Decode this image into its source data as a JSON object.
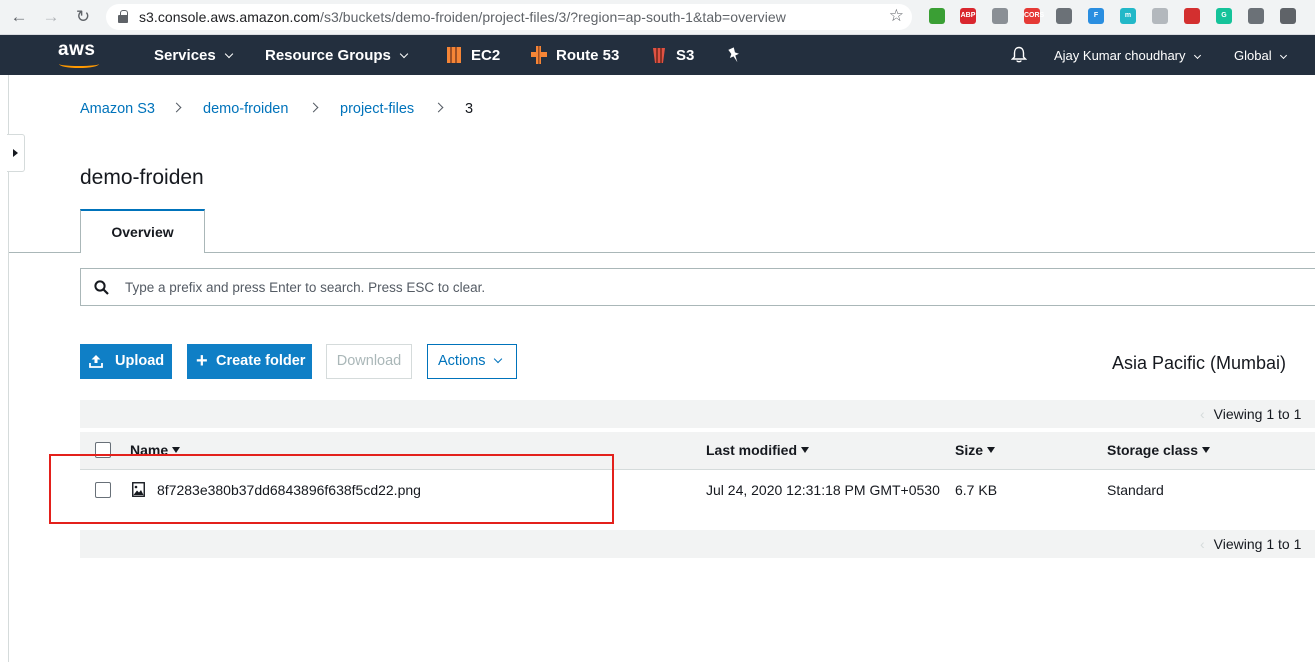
{
  "browser": {
    "url_host": "s3.console.aws.amazon.com",
    "url_path": "/s3/buckets/demo-froiden/project-files/3/?region=ap-south-1&tab=overview",
    "extensions": [
      {
        "name": "evernote-icon",
        "label": "",
        "color": "#3a9f34"
      },
      {
        "name": "adblock-plus-icon",
        "label": "ABP",
        "color": "#d9262e"
      },
      {
        "name": "vuejs-devtools-icon",
        "label": "",
        "color": "#8a8f95"
      },
      {
        "name": "cors-icon",
        "label": "CORS",
        "color": "#e53935"
      },
      {
        "name": "code-braces-icon",
        "label": "",
        "color": "#6b7177"
      },
      {
        "name": "font-icon",
        "label": "F",
        "color": "#2a8ee0"
      },
      {
        "name": "mercury-icon",
        "label": "m",
        "color": "#22b8c8"
      },
      {
        "name": "shape-icon",
        "label": "",
        "color": "#b3b8bd"
      },
      {
        "name": "pin-icon",
        "label": "",
        "color": "#d32f2f"
      },
      {
        "name": "grammarly-icon",
        "label": "G",
        "color": "#15c39a"
      },
      {
        "name": "camera-icon",
        "label": "",
        "color": "#6b7177"
      },
      {
        "name": "download-icon",
        "label": "",
        "color": "#5f6368"
      }
    ]
  },
  "aws_nav": {
    "logo_text": "aws",
    "services": "Services",
    "resource_groups": "Resource Groups",
    "shortcuts": [
      {
        "label": "EC2",
        "icon": "ec2-icon",
        "color": "#f58536"
      },
      {
        "label": "Route 53",
        "icon": "route53-icon",
        "color": "#f58536"
      },
      {
        "label": "S3",
        "icon": "s3-icon",
        "color": "#e05243"
      }
    ],
    "user": "Ajay Kumar choudhary",
    "region": "Global"
  },
  "breadcrumb": [
    "Amazon S3",
    "demo-froiden",
    "project-files",
    "3"
  ],
  "page_title": "demo-froiden",
  "tabs": [
    {
      "label": "Overview"
    }
  ],
  "search": {
    "placeholder": "Type a prefix and press Enter to search. Press ESC to clear."
  },
  "toolbar": {
    "upload": "Upload",
    "create_folder": "Create folder",
    "download": "Download",
    "actions": "Actions",
    "region": "Asia Pacific (Mumbai)"
  },
  "table": {
    "viewing": "Viewing 1 to 1",
    "columns": [
      "Name",
      "Last modified",
      "Size",
      "Storage class"
    ],
    "rows": [
      {
        "name": "8f7283e380b37dd6843896f638f5cd22.png",
        "last_modified": "Jul 24, 2020 12:31:18 PM GMT+0530",
        "size": "6.7 KB",
        "storage_class": "Standard"
      }
    ]
  },
  "colors": {
    "aws_nav_bg": "#232f3e",
    "aws_orange": "#ff9900",
    "link_blue": "#0073bb",
    "primary_button": "#0f7fc6",
    "highlight_red": "#e3201b"
  }
}
